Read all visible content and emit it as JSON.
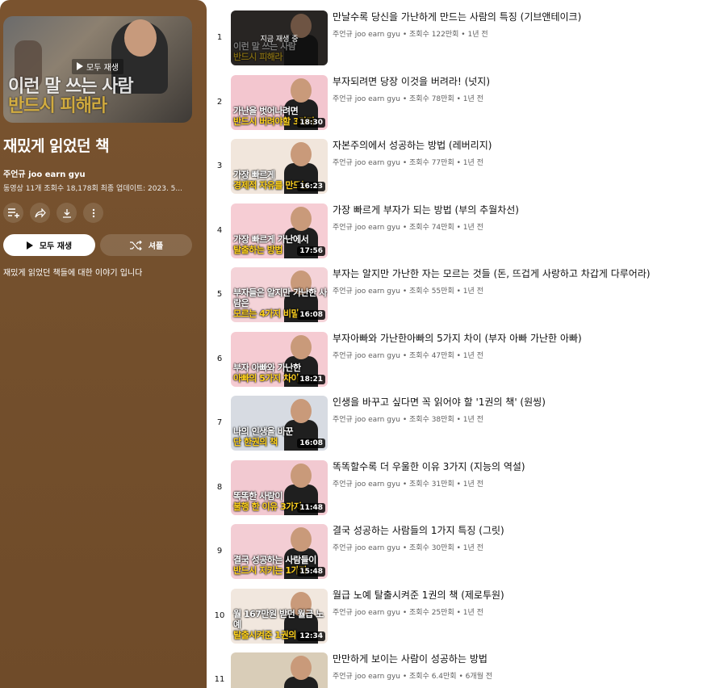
{
  "playlist": {
    "hero_caption_line1": "이런 말 쓰는 사람",
    "hero_caption_line2": "반드시 피해라",
    "hero_play_label": "모두 재생",
    "title": "재밌게 읽었던 책",
    "owner": "주언규 joo earn gyu",
    "stats": "동영상 11개  조회수 18,178회  최종 업데이트: 2023. 5...",
    "icons": [
      "add-to-queue-icon",
      "share-icon",
      "download-icon",
      "more-vert-icon"
    ],
    "play_all_label": "모두 재생",
    "shuffle_label": "셔플",
    "description": "재밌게 읽었던 책들에 대한 이야기 입니다"
  },
  "videos": [
    {
      "index": "1",
      "title": "만날수록 당신을 가난하게 만드는 사람의 특징 (기브앤테이크)",
      "meta": "주언규 joo earn gyu • 조회수 122만회 • 1년 전",
      "now_playing": "지금 재생 중",
      "cap1": "이런 말 쓰는 사람",
      "cap2": "반드시 피해라",
      "duration": "",
      "bg": "#4a4440"
    },
    {
      "index": "2",
      "title": "부자되려면 당장 이것을 버려라! (넛지)",
      "meta": "주언규 joo earn gyu • 조회수 78만회 • 1년 전",
      "now_playing": "",
      "cap1": "가난을 벗어나려면",
      "cap2": "반드시 버려야할 3가지",
      "duration": "18:30",
      "bg": "#f3c6cf"
    },
    {
      "index": "3",
      "title": "자본주의에서 성공하는 방법 (레버리지)",
      "meta": "주언규 joo earn gyu • 조회수 77만회 • 1년 전",
      "now_playing": "",
      "cap1": "가장 빠르게",
      "cap2": "경제적 자유를 만드는",
      "duration": "16:23",
      "bg": "#f1e6dc"
    },
    {
      "index": "4",
      "title": "가장 빠르게 부자가 되는 방법 (부의 추월차선)",
      "meta": "주언규 joo earn gyu • 조회수 74만회 • 1년 전",
      "now_playing": "",
      "cap1": "가장 빠르게 가난에서",
      "cap2": "탈출하는 방법",
      "duration": "17:56",
      "bg": "#f6cdd4"
    },
    {
      "index": "5",
      "title": "부자는 알지만 가난한 자는 모르는 것들 (돈, 뜨겁게 사랑하고 차갑게 다루어라)",
      "meta": "주언규 joo earn gyu • 조회수 55만회 • 1년 전",
      "now_playing": "",
      "cap1": "부자들은 알지만 가난한 사람은",
      "cap2": "모르는 4가지 비밀",
      "duration": "16:08",
      "bg": "#f4d3d8"
    },
    {
      "index": "6",
      "title": "부자아빠와 가난한아빠의 5가지 차이 (부자 아빠 가난한 아빠)",
      "meta": "주언규 joo earn gyu • 조회수 47만회 • 1년 전",
      "now_playing": "",
      "cap1": "부자 아빠와 가난한",
      "cap2": "아빠의 5가지 차이",
      "duration": "18:21",
      "bg": "#f5cbd2"
    },
    {
      "index": "7",
      "title": "인생을 바꾸고 싶다면 꼭 읽어야 할 '1권의 책' (원씽)",
      "meta": "주언규 joo earn gyu • 조회수 38만회 • 1년 전",
      "now_playing": "",
      "cap1": "나의 인생을 바꾼",
      "cap2": "단 한권의 책",
      "duration": "16:08",
      "bg": "#d7dbe2"
    },
    {
      "index": "8",
      "title": "똑똑할수록 더 우울한 이유 3가지 (지능의 역설)",
      "meta": "주언규 joo earn gyu • 조회수 31만회 • 1년 전",
      "now_playing": "",
      "cap1": "똑똑한 사람이",
      "cap2": "불행 한 이유 3가지",
      "duration": "11:48",
      "bg": "#f2c9d1"
    },
    {
      "index": "9",
      "title": "결국 성공하는 사람들의 1가지 특징 (그릿)",
      "meta": "주언규 joo earn gyu • 조회수 30만회 • 1년 전",
      "now_playing": "",
      "cap1": "결국 성공하는 사람들이",
      "cap2": "반드시 지키는 1가지",
      "duration": "15:48",
      "bg": "#f3cdd4"
    },
    {
      "index": "10",
      "title": "월급 노예 탈출시켜준 1권의 책 (제로투원)",
      "meta": "주언규 joo earn gyu • 조회수 25만회 • 1년 전",
      "now_playing": "",
      "cap1": "월 167만원 받던 월급 노예",
      "cap2": "탈출시켜준 1권의",
      "duration": "12:34",
      "bg": "#f1e7de"
    },
    {
      "index": "11",
      "title": "만만하게 보이는 사람이 성공하는 방법",
      "meta": "주언규 joo earn gyu • 조회수 6.4만회 • 6개월 전",
      "now_playing": "",
      "cap1": "",
      "cap2": "",
      "duration": "",
      "bg": "#d9cdb8"
    }
  ],
  "colors": {
    "panel": "#74502d",
    "accent_yellow": "#ffd21f"
  }
}
